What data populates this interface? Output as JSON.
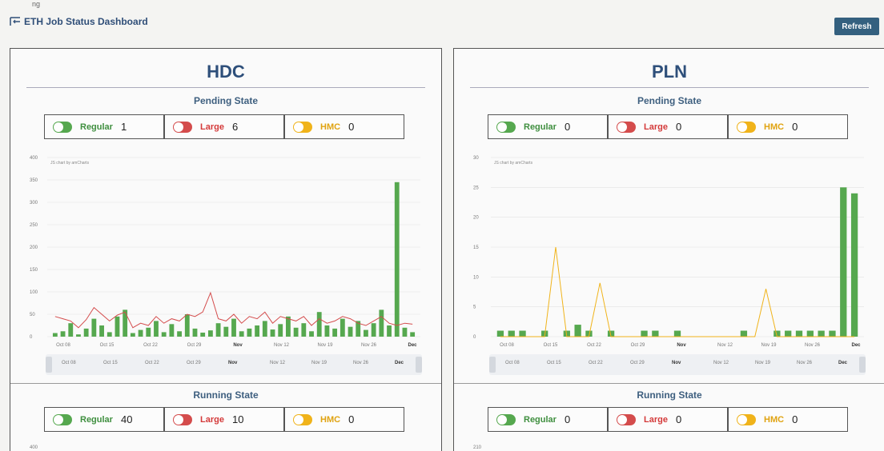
{
  "header": {
    "top_text": "ng",
    "title": "ETH Job Status Dashboard",
    "refresh_label": "Refresh"
  },
  "panels": [
    {
      "site": "HDC",
      "pending_title": "Pending State",
      "pending_cards": [
        {
          "label": "Regular",
          "value": "1",
          "color": "#56a84f"
        },
        {
          "label": "Large",
          "value": "6",
          "color": "#d44c4c"
        },
        {
          "label": "HMC",
          "value": "0",
          "color": "#f0b31a"
        }
      ],
      "running_title": "Running State",
      "running_cards": [
        {
          "label": "Regular",
          "value": "40",
          "color": "#56a84f"
        },
        {
          "label": "Large",
          "value": "10",
          "color": "#d44c4c"
        },
        {
          "label": "HMC",
          "value": "0",
          "color": "#f0b31a"
        }
      ],
      "chart_caption": "JS chart by amCharts",
      "y_ticks": [
        "400",
        "350",
        "300",
        "250",
        "200",
        "150",
        "100",
        "50",
        "0"
      ],
      "x_ticks": [
        "Oct 08",
        "Oct 15",
        "Oct 22",
        "Oct 29",
        "Nov",
        "Nov 12",
        "Nov 19",
        "Nov 26",
        "Dec"
      ],
      "x_bold": [
        false,
        false,
        false,
        false,
        true,
        false,
        false,
        false,
        true
      ],
      "scroll_ticks": [
        "Oct 08",
        "Oct 15",
        "Oct 22",
        "Oct 29",
        "Nov",
        "Nov 12",
        "Nov 19",
        "Nov 26",
        "Dec"
      ],
      "running_y_top": "400"
    },
    {
      "site": "PLN",
      "pending_title": "Pending State",
      "pending_cards": [
        {
          "label": "Regular",
          "value": "0",
          "color": "#56a84f"
        },
        {
          "label": "Large",
          "value": "0",
          "color": "#d44c4c"
        },
        {
          "label": "HMC",
          "value": "0",
          "color": "#f0b31a"
        }
      ],
      "running_title": "Running State",
      "running_cards": [
        {
          "label": "Regular",
          "value": "0",
          "color": "#56a84f"
        },
        {
          "label": "Large",
          "value": "0",
          "color": "#d44c4c"
        },
        {
          "label": "HMC",
          "value": "0",
          "color": "#f0b31a"
        }
      ],
      "chart_caption": "JS chart by amCharts",
      "y_ticks": [
        "30",
        "25",
        "20",
        "15",
        "10",
        "5",
        "0"
      ],
      "x_ticks": [
        "Oct 08",
        "Oct 15",
        "Oct 22",
        "Oct 29",
        "Nov",
        "Nov 12",
        "Nov 19",
        "Nov 26",
        "Dec"
      ],
      "x_bold": [
        false,
        false,
        false,
        false,
        true,
        false,
        false,
        false,
        true
      ],
      "scroll_ticks": [
        "Oct 08",
        "Oct 15",
        "Oct 22",
        "Oct 29",
        "Nov",
        "Nov 12",
        "Nov 19",
        "Nov 26",
        "Dec"
      ],
      "running_y_top": "210"
    }
  ],
  "chart_data": [
    {
      "type": "bar",
      "site": "HDC",
      "ylim": [
        0,
        400
      ],
      "series": [
        {
          "name": "Regular",
          "color": "#56a84f",
          "values": [
            8,
            12,
            30,
            5,
            18,
            40,
            25,
            10,
            45,
            60,
            8,
            15,
            20,
            35,
            10,
            28,
            12,
            50,
            18,
            9,
            14,
            30,
            22,
            40,
            12,
            18,
            25,
            35,
            16,
            28,
            45,
            20,
            30,
            12,
            55,
            25,
            18,
            40,
            22,
            35,
            15,
            30,
            60,
            25,
            345,
            20,
            10
          ]
        },
        {
          "name": "Large",
          "color": "#d44c4c",
          "values": [
            45,
            40,
            35,
            20,
            38,
            65,
            50,
            35,
            48,
            55,
            20,
            30,
            25,
            45,
            30,
            40,
            35,
            50,
            45,
            55,
            98,
            40,
            35,
            50,
            30,
            45,
            40,
            55,
            30,
            45,
            40,
            35,
            45,
            25,
            40,
            30,
            35,
            45,
            40,
            30,
            25,
            35,
            45,
            30,
            25,
            30,
            28
          ]
        }
      ]
    },
    {
      "type": "bar",
      "site": "PLN",
      "ylim": [
        0,
        30
      ],
      "series": [
        {
          "name": "Regular",
          "color": "#56a84f",
          "values": [
            1,
            1,
            1,
            0,
            1,
            0,
            1,
            2,
            1,
            0,
            1,
            0,
            0,
            1,
            1,
            0,
            1,
            0,
            0,
            0,
            0,
            0,
            1,
            0,
            0,
            1,
            1,
            1,
            1,
            1,
            1,
            25,
            24
          ]
        },
        {
          "name": "HMC",
          "color": "#f0b31a",
          "values": [
            0,
            0,
            0,
            0,
            0,
            15,
            0,
            0,
            0,
            9,
            0,
            0,
            0,
            0,
            0,
            0,
            0,
            0,
            0,
            0,
            0,
            0,
            0,
            0,
            8,
            0,
            0,
            0,
            0,
            0,
            0,
            0,
            0
          ]
        }
      ]
    }
  ]
}
